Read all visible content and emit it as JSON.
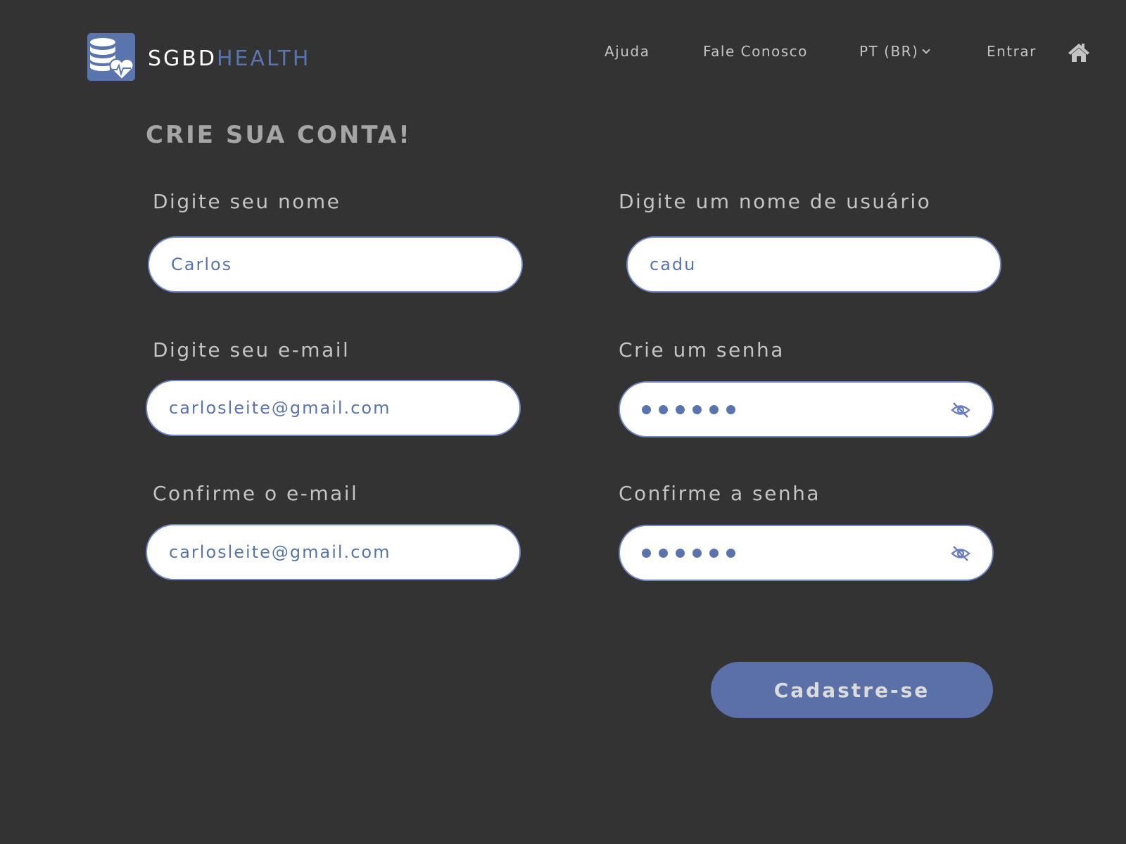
{
  "header": {
    "brand_primary": "SGBD",
    "brand_accent": "HEALTH",
    "logo_icon": "database-heart-icon",
    "nav": {
      "help": "Ajuda",
      "contact": "Fale Conosco",
      "language": "PT (BR)",
      "login": "Entrar"
    },
    "home_icon": "home-icon"
  },
  "page": {
    "title": "CRIE SUA CONTA!"
  },
  "form": {
    "name": {
      "label": "Digite seu nome",
      "value": "Carlos"
    },
    "username": {
      "label": "Digite um nome de usuário",
      "value": "cadu"
    },
    "email": {
      "label": "Digite seu e-mail",
      "value": "carlosleite@gmail.com"
    },
    "password": {
      "label": "Crie um senha",
      "masked_length": 6,
      "toggle_icon": "eye-slash-icon"
    },
    "email_confirm": {
      "label": "Confirme o e-mail",
      "value": "carlosleite@gmail.com"
    },
    "password_confirm": {
      "label": "Confirme a senha",
      "masked_length": 6,
      "toggle_icon": "eye-slash-icon"
    },
    "submit_label": "Cadastre-se"
  },
  "colors": {
    "background": "#333333",
    "accent": "#5a74ad",
    "button": "#5a70a6",
    "field_border": "#6f87c6",
    "label_text": "#c4c4c4"
  }
}
